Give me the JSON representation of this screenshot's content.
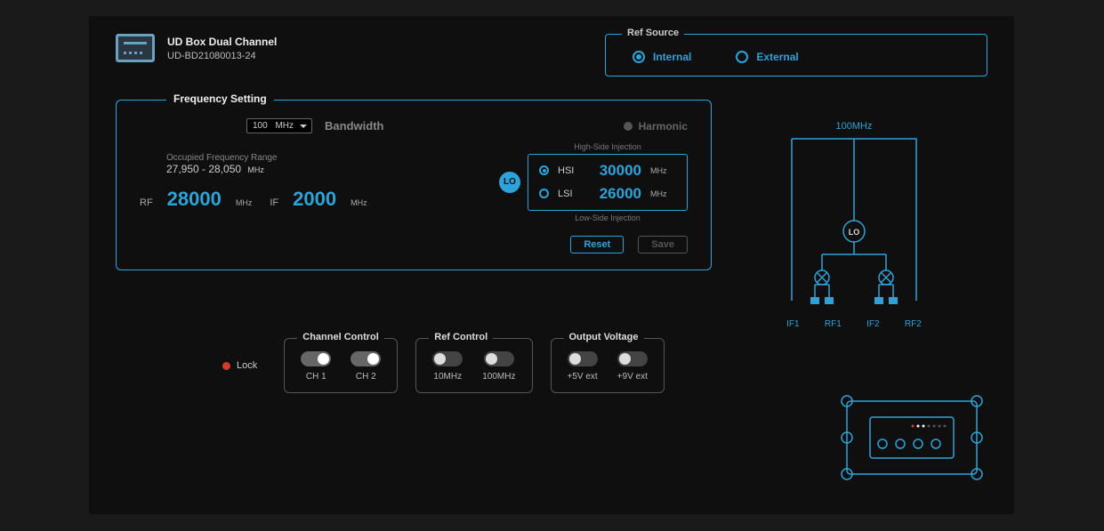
{
  "device": {
    "title": "UD Box Dual Channel",
    "model": "UD-BD21080013-24"
  },
  "ref_source": {
    "title": "Ref Source",
    "internal": "Internal",
    "external": "External",
    "selected": "internal"
  },
  "freq": {
    "title": "Frequency Setting",
    "bandwidth": {
      "value": "100",
      "unit": "MHz",
      "label": "Bandwidth"
    },
    "harmonic": "Harmonic",
    "occ_label": "Occupied Frequency Range",
    "occ_value": "27,950 - 28,050",
    "occ_unit": "MHz",
    "rf": {
      "name": "RF",
      "value": "28000",
      "unit": "MHz"
    },
    "if": {
      "name": "IF",
      "value": "2000",
      "unit": "MHz"
    },
    "lo": {
      "badge": "LO",
      "hsi_note": "High-Side Injection",
      "lsi_note": "Low-Side Injection",
      "hsi": {
        "name": "HSI",
        "value": "30000",
        "unit": "MHz"
      },
      "lsi": {
        "name": "LSI",
        "value": "26000",
        "unit": "MHz"
      },
      "selected": "hsi"
    },
    "reset": "Reset",
    "save": "Save"
  },
  "diagram": {
    "top_label": "100MHz",
    "lo": "LO",
    "ports": [
      "IF1",
      "RF1",
      "IF2",
      "RF2"
    ]
  },
  "lock": "Lock",
  "channel_control": {
    "title": "Channel Control",
    "ch1": "CH 1",
    "ch2": "CH 2"
  },
  "ref_control": {
    "title": "Ref Control",
    "a": "10MHz",
    "b": "100MHz"
  },
  "output_voltage": {
    "title": "Output Voltage",
    "a": "+5V ext",
    "b": "+9V ext"
  }
}
